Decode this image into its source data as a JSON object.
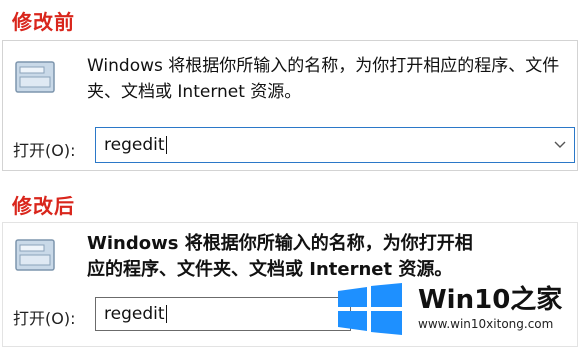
{
  "before": {
    "title": "修改前",
    "description": "Windows 将根据你所输入的名称，为你打开相应的程序、文件夹、文档或 Internet 资源。",
    "open_label": "打开(O):",
    "input_value": "regedit"
  },
  "after": {
    "title": "修改后",
    "description": "Windows 将根据你所输入的名称，为你打开相应的程序、文件夹、文档或 Internet 资源。",
    "open_label": "打开(O):",
    "input_value": "regedit"
  },
  "watermark": {
    "brand": "Win10之家",
    "url": "www.win10xitong.com"
  },
  "colors": {
    "title_red": "#d9261c",
    "input_border": "#2b78c8",
    "win_blue": "#1e90ff"
  },
  "icons": [
    "run-dialog-icon",
    "chevron-down-icon",
    "windows-logo-icon"
  ]
}
